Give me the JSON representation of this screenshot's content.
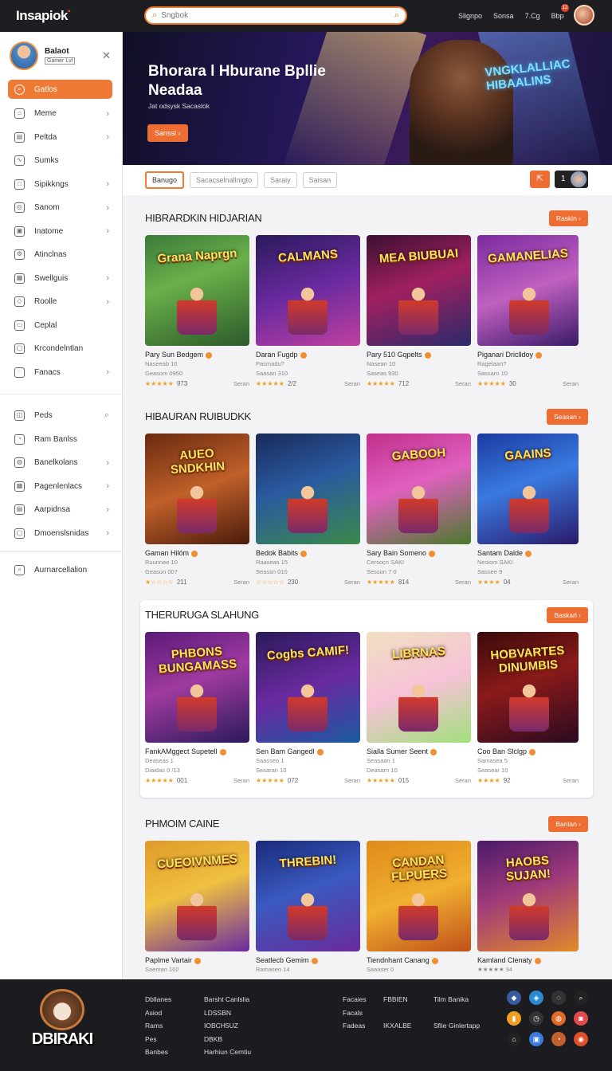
{
  "app": {
    "logo": "Insapiok",
    "logo_badge": "°"
  },
  "search": {
    "placeholder": "Sngbok"
  },
  "topnav": [
    "Slignpo",
    "Sonsa",
    "7.Cg",
    "Bbp"
  ],
  "topbar_badge": "12",
  "profile": {
    "name": "Balaot",
    "tag": "Gamer Lvl"
  },
  "sidebar": {
    "items": [
      {
        "label": "Gatlos",
        "icon": "search-icon",
        "chev": false,
        "active": true
      },
      {
        "label": "Meme",
        "icon": "home-icon",
        "chev": true
      },
      {
        "label": "Peltda",
        "icon": "chart-icon",
        "chev": true
      },
      {
        "label": "Sumks",
        "icon": "trend-icon",
        "chev": false
      },
      {
        "label": "Sipikkngs",
        "icon": "square-icon",
        "chev": true
      },
      {
        "label": "Sanom",
        "icon": "compass-icon",
        "chev": true
      },
      {
        "label": "Inatome",
        "icon": "image-icon",
        "chev": true
      },
      {
        "label": "Atinclnas",
        "icon": "settings-icon",
        "chev": false
      },
      {
        "label": "Swellguis",
        "icon": "grid-icon",
        "chev": true
      },
      {
        "label": "Roolle",
        "icon": "tag-icon",
        "chev": true
      },
      {
        "label": "Ceplal",
        "icon": "folder-icon",
        "chev": false
      },
      {
        "label": "Krcondelntlan",
        "icon": "box-icon",
        "chev": false
      },
      {
        "label": "Fanacs",
        "icon": "chat-icon",
        "chev": true
      }
    ],
    "items2": [
      {
        "label": "Peds",
        "icon": "bag-icon",
        "chev": false,
        "search": true
      },
      {
        "label": "Ram Banlss",
        "icon": "user-icon",
        "chev": false
      },
      {
        "label": "Banelkolans",
        "icon": "globe-icon",
        "chev": true
      },
      {
        "label": "Pagenlenlacs",
        "icon": "grid-icon",
        "chev": true
      },
      {
        "label": "Aarpidnsa",
        "icon": "chart-icon",
        "chev": true
      },
      {
        "label": "Dmoenslsnidas",
        "icon": "box-icon",
        "chev": true
      }
    ],
    "items3": [
      {
        "label": "Aurnarcellalion",
        "icon": "search-icon",
        "chev": false
      }
    ]
  },
  "hero": {
    "title": "Bhorara l Hburane Bpllie Neadaa",
    "subtitle": "Jat odsysk Sacaslok",
    "button": "Sanssl ›",
    "neon": "VNGKLALLIAC HIBAALINS"
  },
  "filters": {
    "chips": [
      "Banugo",
      "Sacacselnallnigto",
      "Saraiy",
      "Saisan"
    ],
    "right_label": "1"
  },
  "sections": [
    {
      "title": "HIBRARDKIN HIDJARIAN",
      "button": "Raskin ›",
      "cards": [
        {
          "art": "Grana Naprgn",
          "title": "Pary Sun Bedgem",
          "m1": "Naseeab 10",
          "m2": "Geasom 0950",
          "rating": "★★★★★",
          "count": "973",
          "link": "Seran",
          "bg": "linear-gradient(160deg,#3a7a3a,#6ab04a 40%,#2c5a2a)"
        },
        {
          "art": "CALMANS",
          "title": "Daran Fugdp",
          "m1": "Pasmadu?",
          "m2": "Saasan 310",
          "rating": "★★★★★",
          "count": "2/2",
          "link": "Seran",
          "bg": "linear-gradient(160deg,#2a1a5a,#6a2aa0 50%,#c040a0)"
        },
        {
          "art": "MEA BIUBUAI",
          "title": "Pary 510 Gqpelts",
          "m1": "Nasean 10",
          "m2": "Saseas 930",
          "rating": "★★★★★",
          "count": "712",
          "link": "Seran",
          "bg": "linear-gradient(160deg,#3a1030,#a02060 45%,#2a2a6a)"
        },
        {
          "art": "GAMANELIAS",
          "title": "Piganari Driclldoy",
          "m1": "Ragelaan?",
          "m2": "Sassaro 10",
          "rating": "★★★★★",
          "count": "30",
          "link": "Seran",
          "bg": "linear-gradient(160deg,#7a2aa0,#c060c0 50%,#3a1a6a)"
        }
      ]
    },
    {
      "title": "HIBAURAN RUIBUDKK",
      "button": "Seasan ›",
      "cards": [
        {
          "art": "AUEO SNDKHIN",
          "title": "Gaman Hilóm",
          "m1": "Ruunnee 10",
          "m2": "Geason 007",
          "rating": "★☆☆☆☆",
          "count": "211",
          "link": "Seran",
          "bg": "linear-gradient(160deg,#6a2a10,#c0602a 50%,#4a1a0a)"
        },
        {
          "art": "",
          "title": "Bedok Babits",
          "m1": "Raaseas 15",
          "m2": "Seassn 010",
          "rating": "☆☆☆☆☆",
          "count": "230",
          "link": "Seran",
          "bg": "linear-gradient(160deg,#1a2a5a,#2a5aa0 45%,#3a8a4a)"
        },
        {
          "art": "GABOOH",
          "title": "Sary Bain Someno",
          "m1": "Cersocn SAKI",
          "m2": "Sesson 7 0",
          "rating": "★★★★★",
          "count": "814",
          "link": "Seran",
          "bg": "linear-gradient(160deg,#c0308a,#e060c0 45%,#4a7a2a)"
        },
        {
          "art": "GAAINS",
          "title": "Santam Dalde",
          "m1": "Nesiom SAKI",
          "m2": "Sassee 9",
          "rating": "★★★★",
          "count": "04",
          "link": "Seran",
          "bg": "linear-gradient(160deg,#1a3aa0,#3a7ae0 45%,#2a1a6a)"
        }
      ]
    },
    {
      "title": "THERURUGA SLAHUNG",
      "button": "Baskarl ›",
      "cards": [
        {
          "art": "PHBONS BUNGAMASS",
          "title": "FankAMggect Supetell",
          "m1": "Deaseas 1",
          "m2": "Diaidas 0 /13",
          "rating": "★★★★★",
          "count": "001",
          "link": "Seran",
          "bg": "linear-gradient(160deg,#5a1a7a,#a03aa0 45%,#2a1a5a)"
        },
        {
          "art": "Cogbs CAMIF!",
          "title": "Sen Bam Gangedl",
          "m1": "Saasseo 1",
          "m2": "Sesaran 10",
          "rating": "★★★★★",
          "count": "072",
          "link": "Seran",
          "bg": "linear-gradient(160deg,#2a1a5a,#6a2aa0 50%,#1a5aa0)"
        },
        {
          "art": "LIBRNAS",
          "title": "Sialla Sumer Seent",
          "m1": "Seasaan 1",
          "m2": "Deasarn 10",
          "rating": "★★★★★",
          "count": "015",
          "link": "Seran",
          "bg": "linear-gradient(160deg,#f0e0c0,#f7c2d8 50%,#a0e07a)"
        },
        {
          "art": "HOBVARTES DINUMBIS",
          "title": "Coo Ban Slclgp",
          "m1": "Samasea 5",
          "m2": "Seasear 10",
          "rating": "★★★★",
          "count": "92",
          "link": "Seran",
          "bg": "linear-gradient(160deg,#3a0a0a,#8a1a1a 45%,#2a0a20)"
        }
      ]
    },
    {
      "title": "PHMOIM CAINE",
      "button": "Banlan ›",
      "cards": [
        {
          "art": "CUEOIVNMES",
          "title": "Paplme Vartair",
          "m1": "Saeman 102",
          "m2": "",
          "rating": "",
          "count": "",
          "link": "",
          "bg": "linear-gradient(160deg,#e09a2a,#f0c040 45%,#6a2aa0)"
        },
        {
          "art": "THREBIN!",
          "title": "Seatlecb Gemim",
          "m1": "Ramaseo 14",
          "m2": "",
          "rating": "",
          "count": "",
          "link": "",
          "bg": "linear-gradient(160deg,#1a2a7a,#3a5ac0 45%,#6a2a9a)"
        },
        {
          "art": "CANDAN FLPUERS",
          "title": "Tiendnhant Canang",
          "m1": "Saaaser 0",
          "m2": "",
          "rating": "",
          "count": "",
          "link": "",
          "bg": "linear-gradient(160deg,#e08a1a,#f0b030 50%,#c0501a)"
        },
        {
          "art": "HAOBS SUJAN!",
          "title": "Kamland Clenaty",
          "m1": "★★★★★ 94",
          "m2": "",
          "rating": "",
          "count": "",
          "link": "",
          "bg": "linear-gradient(160deg,#4a1a6a,#a03a7a 45%,#e08a2a)"
        }
      ]
    }
  ],
  "footer": {
    "logo": "DBIRAKI",
    "col1": [
      "Dbllanes",
      "Asiod",
      "Rams",
      "Pes",
      "Banbes"
    ],
    "col2": [
      "Barsht Canlslia",
      "LDSSBN",
      "IOBCH5UZ",
      "DBKB",
      "Harhiun Cemtiu"
    ],
    "col3": [
      "Facaies",
      "Facals",
      "Fadeas"
    ],
    "col4": [
      "FBBIEN",
      "",
      "IKXALBE"
    ],
    "col5": [
      "Tilm Banika",
      "",
      "Sflie Ginlertapp"
    ],
    "icons": [
      "shield-icon",
      "diamond-icon",
      "chat-icon",
      "search-icon",
      "bag-icon",
      "clock-icon",
      "globe-icon",
      "gamepad-icon",
      "home-icon",
      "image-icon",
      "user-icon",
      "controller-icon"
    ]
  }
}
